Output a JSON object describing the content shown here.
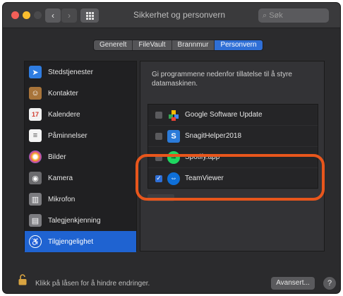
{
  "window": {
    "title": "Sikkerhet og personvern"
  },
  "search": {
    "placeholder": "Søk"
  },
  "tabs": [
    {
      "label": "Generelt"
    },
    {
      "label": "FileVault"
    },
    {
      "label": "Brannmur"
    },
    {
      "label": "Personvern",
      "active": true
    }
  ],
  "sidebar": {
    "items": [
      {
        "label": "Stedstjenester",
        "icon": "location-arrow-icon"
      },
      {
        "label": "Kontakter",
        "icon": "contacts-book-icon"
      },
      {
        "label": "Kalendere",
        "icon": "calendar-icon"
      },
      {
        "label": "Påminnelser",
        "icon": "reminders-list-icon"
      },
      {
        "label": "Bilder",
        "icon": "photos-flower-icon"
      },
      {
        "label": "Kamera",
        "icon": "camera-icon"
      },
      {
        "label": "Mikrofon",
        "icon": "microphone-icon"
      },
      {
        "label": "Talegjenkjenning",
        "icon": "speech-recognition-icon"
      },
      {
        "label": "Tilgjengelighet",
        "icon": "accessibility-icon",
        "active": true
      }
    ]
  },
  "main": {
    "description": "Gi programmene nedenfor tillatelse til å styre datamaskinen.",
    "apps": [
      {
        "name": "Google Software Update",
        "checked": false,
        "icon": "google-update-icon"
      },
      {
        "name": "SnagitHelper2018",
        "checked": false,
        "icon": "snagit-icon"
      },
      {
        "name": "Spotify.app",
        "checked": false,
        "icon": "spotify-icon"
      },
      {
        "name": "TeamViewer",
        "checked": true,
        "icon": "teamviewer-icon"
      }
    ]
  },
  "footer": {
    "lock_text": "Klikk på låsen for å hindre endringer.",
    "advanced_label": "Avansert...",
    "help_label": "?"
  },
  "colors": {
    "accent": "#2f6fd6",
    "highlight": "#e8561c"
  }
}
